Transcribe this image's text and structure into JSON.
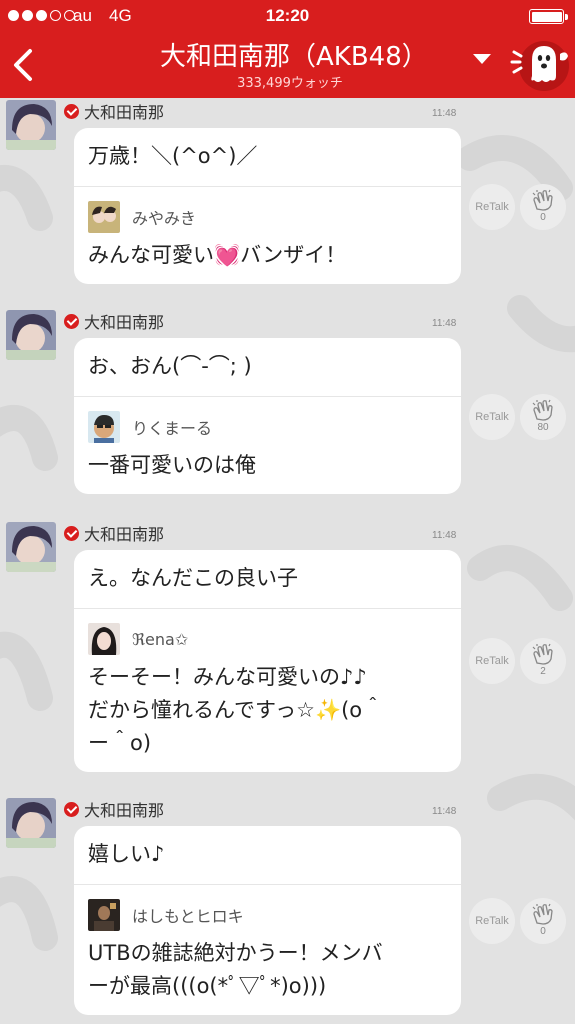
{
  "status_bar": {
    "carrier": "au",
    "network": "4G",
    "time": "12:20"
  },
  "header": {
    "title": "大和田南那（AKB48）",
    "subtitle": "333,499ウォッチ",
    "back_icon": "chevron-left-icon",
    "menu_icon": "caret-down-icon",
    "mascot_icon": "mascot-icon"
  },
  "colors": {
    "brand_red": "#d81e1e",
    "background": "#e2e2e2",
    "bubble": "#ffffff"
  },
  "posts": [
    {
      "author": "大和田南那",
      "time": "11:48",
      "text": "万歳！＼(^o^)／",
      "reply": {
        "name": "みやみき",
        "text_before": "みんな可愛い",
        "emoji": "💓",
        "text_after": "バンザイ！"
      },
      "retalk_label": "ReTalk",
      "clap_count": "0"
    },
    {
      "author": "大和田南那",
      "time": "11:48",
      "text": "お、おん(⌒-⌒; )",
      "reply": {
        "name": "りくまーる",
        "text": "一番可愛いのは俺"
      },
      "retalk_label": "ReTalk",
      "clap_count": "80"
    },
    {
      "author": "大和田南那",
      "time": "11:48",
      "text": "え。なんだこの良い子",
      "reply": {
        "name": "ℜena✩",
        "line1": "そーそー！みんな可愛いの♪♪",
        "line2_before": "だから憧れるんですっ☆",
        "line2_emoji": "✨",
        "line2_after": "(o＾",
        "line3": "ー＾o)"
      },
      "retalk_label": "ReTalk",
      "clap_count": "2"
    },
    {
      "author": "大和田南那",
      "time": "11:48",
      "text": "嬉しい♪",
      "reply": {
        "name": "はしもとヒロキ",
        "line1": "UTBの雑誌絶対かうー！メンバ",
        "line2": "ーが最高(((o(*ﾟ▽ﾟ*)o)))"
      },
      "retalk_label": "ReTalk",
      "clap_count": "0"
    }
  ]
}
